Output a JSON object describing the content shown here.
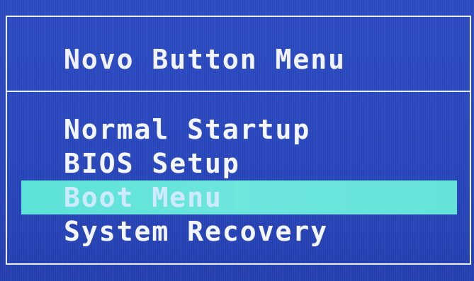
{
  "menu": {
    "title": "Novo Button Menu",
    "items": [
      {
        "label": "Normal Startup",
        "selected": false
      },
      {
        "label": "BIOS Setup",
        "selected": false
      },
      {
        "label": "Boot Menu",
        "selected": true
      },
      {
        "label": "System Recovery",
        "selected": false
      }
    ]
  },
  "colors": {
    "background": "#2d4bc2",
    "border": "#e9eef9",
    "text": "#f3f6ff",
    "highlight": "#66e3d9"
  }
}
